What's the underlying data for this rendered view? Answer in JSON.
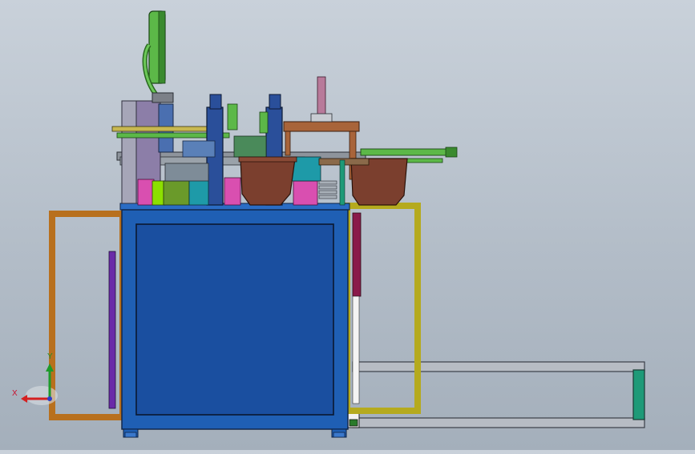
{
  "triad": {
    "x_label": "X",
    "y_label": "Y",
    "colors": {
      "x": "#d42020",
      "y": "#1e9a2a",
      "z": "#2c3fc8"
    }
  },
  "model": {
    "colors": {
      "frame_blue": "#1f5fb4",
      "panel_blue": "#1a4fa0",
      "orange_frame": "#b8701e",
      "olive_frame": "#b5aa1e",
      "bowl_brown": "#7b3f2e",
      "teal": "#1e9a78",
      "green_arm": "#5cb848",
      "magenta": "#d94fb0",
      "purple": "#6a2aa8"
    }
  }
}
